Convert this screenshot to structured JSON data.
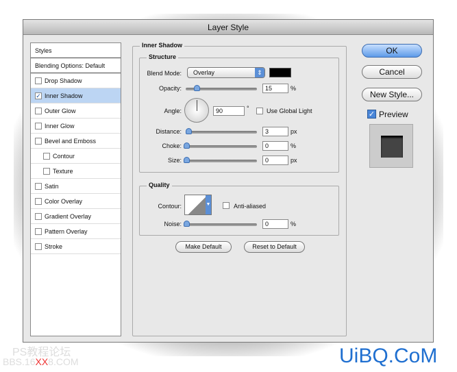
{
  "window": {
    "title": "Layer Style"
  },
  "sidebar": {
    "items": [
      {
        "label": "Styles",
        "type": "header"
      },
      {
        "label": "Blending Options: Default",
        "type": "header"
      },
      {
        "label": "Drop Shadow",
        "checked": false
      },
      {
        "label": "Inner Shadow",
        "checked": true,
        "selected": true
      },
      {
        "label": "Outer Glow",
        "checked": false
      },
      {
        "label": "Inner Glow",
        "checked": false
      },
      {
        "label": "Bevel and Emboss",
        "checked": false
      },
      {
        "label": "Contour",
        "checked": false,
        "indent": true
      },
      {
        "label": "Texture",
        "checked": false,
        "indent": true
      },
      {
        "label": "Satin",
        "checked": false
      },
      {
        "label": "Color Overlay",
        "checked": false
      },
      {
        "label": "Gradient Overlay",
        "checked": false
      },
      {
        "label": "Pattern Overlay",
        "checked": false
      },
      {
        "label": "Stroke",
        "checked": false
      }
    ]
  },
  "panel": {
    "title": "Inner Shadow",
    "structure": {
      "title": "Structure",
      "blend_mode_label": "Blend Mode:",
      "blend_mode": "Overlay",
      "color": "#000000",
      "opacity_label": "Opacity:",
      "opacity": "15",
      "opacity_unit": "%",
      "angle_label": "Angle:",
      "angle": "90",
      "angle_unit": "°",
      "global_light_label": "Use Global Light",
      "global_light": false,
      "distance_label": "Distance:",
      "distance": "3",
      "distance_unit": "px",
      "choke_label": "Choke:",
      "choke": "0",
      "choke_unit": "%",
      "size_label": "Size:",
      "size": "0",
      "size_unit": "px"
    },
    "quality": {
      "title": "Quality",
      "contour_label": "Contour:",
      "anti_aliased_label": "Anti-aliased",
      "anti_aliased": false,
      "noise_label": "Noise:",
      "noise": "0",
      "noise_unit": "%"
    },
    "make_default": "Make Default",
    "reset_default": "Reset to Default"
  },
  "buttons": {
    "ok": "OK",
    "cancel": "Cancel",
    "new_style": "New Style...",
    "preview_label": "Preview",
    "preview_checked": true
  },
  "watermarks": {
    "left1": "PS教程论坛",
    "left2a": "BBS.16",
    "left2b": "XX",
    "left2c": "8.COM",
    "right": "UiBQ.CoM"
  }
}
